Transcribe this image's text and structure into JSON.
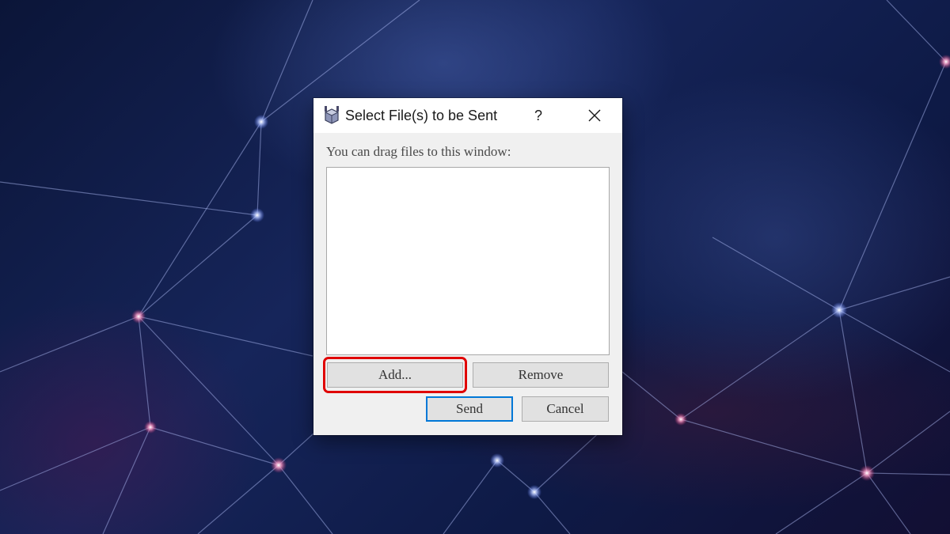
{
  "dialog": {
    "title": "Select File(s) to be Sent",
    "help_label": "?",
    "app_icon": "package-app-icon",
    "close_icon": "close-icon",
    "drag_hint": "You can drag files to this window:",
    "file_list": [],
    "buttons": {
      "add": "Add...",
      "remove": "Remove",
      "send": "Send",
      "cancel": "Cancel"
    }
  },
  "highlight": {
    "target": "add-button",
    "color": "#e00000"
  },
  "colors": {
    "default_button_border": "#0078d7",
    "button_face": "#e1e1e1",
    "dialog_background": "#f0f0f0"
  }
}
